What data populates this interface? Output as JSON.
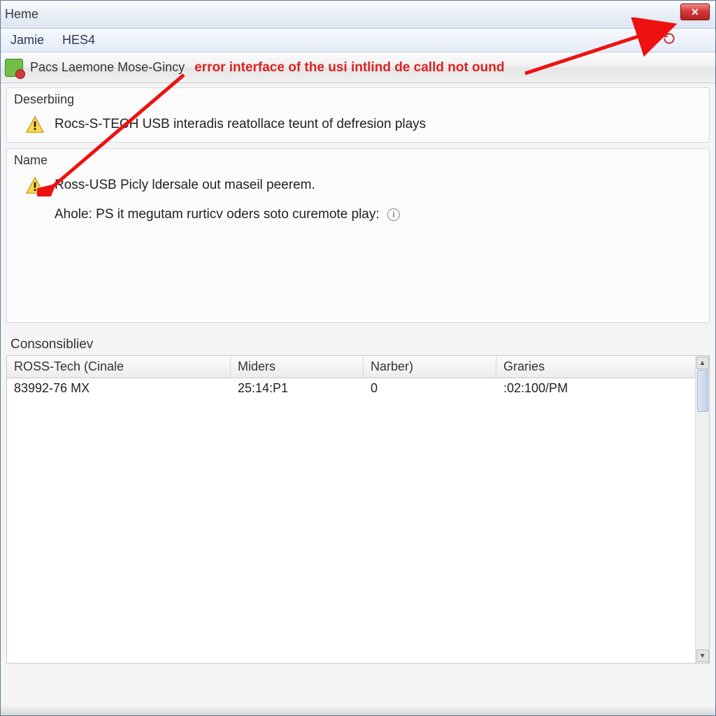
{
  "title_bar": {
    "title": "Heme"
  },
  "close_button": {
    "glyph": "✕"
  },
  "menu": {
    "items": [
      "Jamie",
      "HES4"
    ]
  },
  "toolbar": {
    "label": "Pacs Laemone Mose-Gincy",
    "error_annotation": "error interface of the usi intlind de calld not ound"
  },
  "sections": {
    "describing": {
      "header": "Deserbiing",
      "items": [
        "Rocs-S-TECH USB interadis reatollace teunt of defresion plays"
      ]
    },
    "name": {
      "header": "Name",
      "items": [
        "Ross-USB Picly ldersale out maseil peerem.",
        "Ahole: PS it megutam rurticv oders soto curemote play:"
      ]
    }
  },
  "table": {
    "title": "Consonsibliev",
    "columns": [
      "ROSS-Tech (Cinale",
      "Miders",
      "Narber)",
      "Graries"
    ],
    "rows": [
      [
        "83992-76 MX",
        "25:14:P1",
        "0",
        ":02:100/PM"
      ]
    ]
  }
}
